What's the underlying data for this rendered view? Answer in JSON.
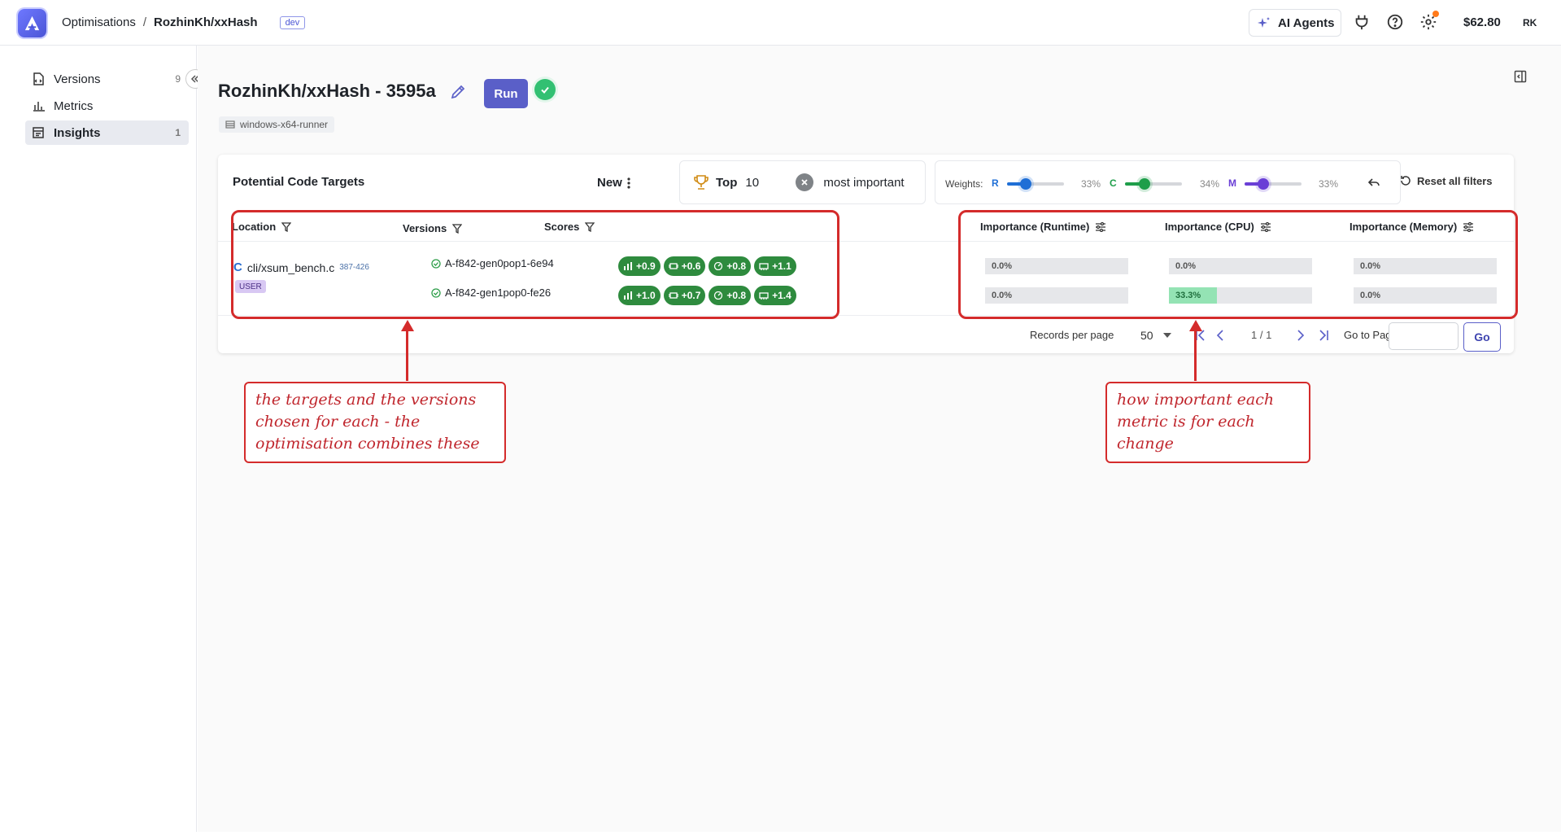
{
  "header": {
    "breadcrumb": [
      "Optimisations",
      "RozhinKh/xxHash"
    ],
    "breadcrumb_sep": "/",
    "env_badge": "dev",
    "agents_label": "AI Agents",
    "credit": "$62.80",
    "user_initials": "RK"
  },
  "sidebar": {
    "items": [
      {
        "label": "Versions",
        "count": "9",
        "icon": "file-code-icon"
      },
      {
        "label": "Metrics",
        "count": "",
        "icon": "bar-chart-icon"
      },
      {
        "label": "Insights",
        "count": "1",
        "icon": "insights-icon",
        "active": true
      }
    ]
  },
  "project": {
    "title": "RozhinKh/xxHash - 3595a",
    "run_label": "Run",
    "runner": "windows-x64-runner"
  },
  "targets": {
    "title": "Potential Code Targets",
    "sort_label": "New",
    "top_label": "Top",
    "top_value": "10",
    "top_suffix": "most important",
    "weights_label": "Weights:",
    "weights": [
      {
        "key": "R",
        "value": 0.33,
        "pct": "33%",
        "color": "#1f6fd6"
      },
      {
        "key": "C",
        "value": 0.34,
        "pct": "34%",
        "color": "#1e9e4a"
      },
      {
        "key": "M",
        "value": 0.33,
        "pct": "33%",
        "color": "#6a3fd6"
      }
    ],
    "reset_label": "Reset all filters",
    "columns": {
      "location": "Location",
      "versions": "Versions",
      "scores": "Scores",
      "imp_runtime": "Importance (Runtime)",
      "imp_cpu": "Importance (CPU)",
      "imp_memory": "Importance (Memory)"
    },
    "row": {
      "file": "cli/xsum_bench.c",
      "range": "387-426",
      "tag": "USER",
      "versions": [
        {
          "name": "A-f842-gen0pop1-6e94",
          "scores": [
            "+0.9",
            "+0.6",
            "+0.8",
            "+1.1"
          ],
          "importance": {
            "runtime": "0.0%",
            "cpu": "0.0%",
            "memory": "0.0%",
            "runtime_v": 0,
            "cpu_v": 0,
            "memory_v": 0
          }
        },
        {
          "name": "A-f842-gen1pop0-fe26",
          "scores": [
            "+1.0",
            "+0.7",
            "+0.8",
            "+1.4"
          ],
          "importance": {
            "runtime": "0.0%",
            "cpu": "33.3%",
            "memory": "0.0%",
            "runtime_v": 0,
            "cpu_v": 0.333,
            "memory_v": 0
          }
        }
      ]
    },
    "pager": {
      "records_label": "Records per page",
      "records_value": "50",
      "page_display": "1 / 1",
      "goto_label": "Go to Page",
      "go_label": "Go"
    }
  },
  "annotations": {
    "left_note": "the targets and the versions chosen for each - the optimisation combines these",
    "right_note": "how important each metric is for each change"
  }
}
